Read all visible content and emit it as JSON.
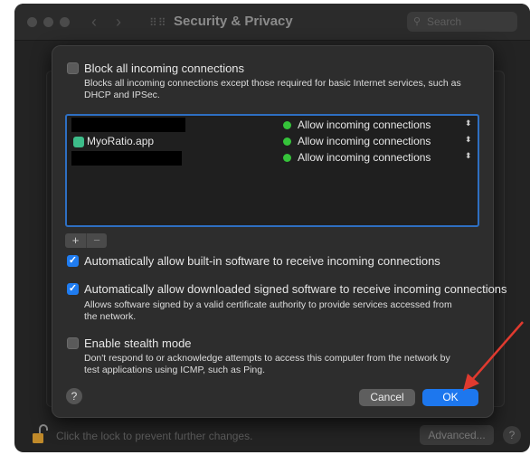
{
  "window": {
    "title": "Security & Privacy",
    "search_placeholder": "Search"
  },
  "bottom_bar": {
    "lock_text": "Click the lock to prevent further changes.",
    "advanced_label": "Advanced...",
    "help_label": "?"
  },
  "firewall_options": {
    "block_all": {
      "label": "Block all incoming connections",
      "checked": false,
      "description": "Blocks all incoming connections except those required for basic Internet services, such as DHCP and IPSec."
    },
    "app_list": [
      {
        "name": "",
        "redacted": true,
        "status": "Allow incoming connections"
      },
      {
        "name": "MyoRatio.app",
        "redacted": false,
        "status": "Allow incoming connections"
      },
      {
        "name": "",
        "redacted": true,
        "status": "Allow incoming connections"
      }
    ],
    "add_label": "+",
    "remove_label": "−",
    "auto_builtin": {
      "label": "Automatically allow built-in software to receive incoming connections",
      "checked": true
    },
    "auto_signed": {
      "label": "Automatically allow downloaded signed software to receive incoming connections",
      "checked": true,
      "description": "Allows software signed by a valid certificate authority to provide services accessed from the network."
    },
    "stealth": {
      "label": "Enable stealth mode",
      "checked": false,
      "description": "Don't respond to or acknowledge attempts to access this computer from the network by test applications using ICMP, such as Ping."
    }
  },
  "dialog_buttons": {
    "help": "?",
    "cancel": "Cancel",
    "ok": "OK"
  },
  "colors": {
    "accent": "#1d77ee",
    "status_green": "#35c33a",
    "annotation_arrow": "#e03a2f"
  }
}
